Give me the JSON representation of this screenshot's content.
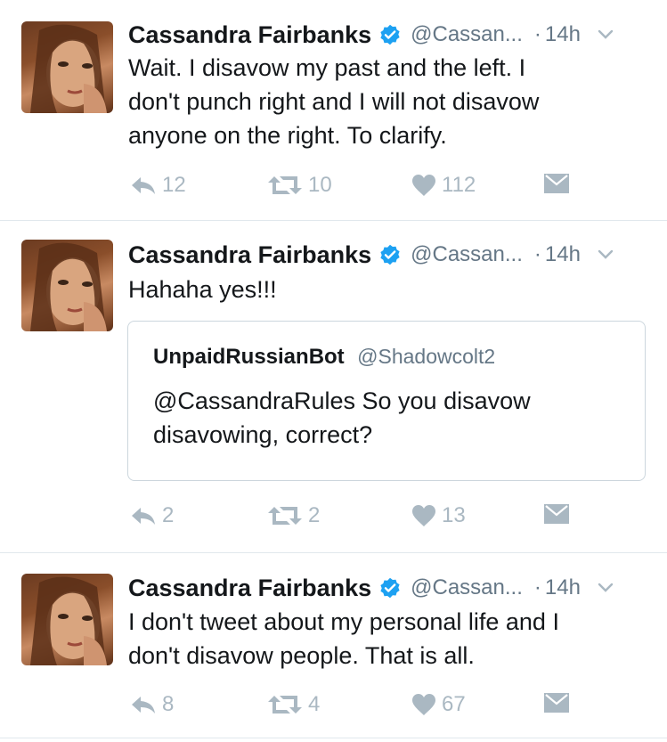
{
  "tweets": [
    {
      "name": "Cassandra Fairbanks",
      "handle": "@Cassan...",
      "time": "14h",
      "text_lines": [
        "Wait. I disavow my past and the left. I",
        "don't punch right and I will not disavow",
        "anyone on the right. To clarify."
      ],
      "replies": "12",
      "retweets": "10",
      "likes": "112"
    },
    {
      "name": "Cassandra Fairbanks",
      "handle": "@Cassan...",
      "time": "14h",
      "text_lines": [
        "Hahaha yes!!!"
      ],
      "quote": {
        "name": "UnpaidRussianBot",
        "handle": "@Shadowcolt2",
        "text_lines": [
          "@CassandraRules So you disavow",
          "disavowing, correct?"
        ]
      },
      "replies": "2",
      "retweets": "2",
      "likes": "13"
    },
    {
      "name": "Cassandra Fairbanks",
      "handle": "@Cassan...",
      "time": "14h",
      "text_lines": [
        "I don't tweet about my personal life and I",
        "don't disavow people. That is all."
      ],
      "replies": "8",
      "retweets": "4",
      "likes": "67"
    }
  ],
  "icons": {
    "verified": "verified-badge-icon",
    "caret": "chevron-down-icon",
    "reply": "reply-icon",
    "retweet": "retweet-icon",
    "like": "heart-icon",
    "dm": "envelope-icon"
  },
  "colors": {
    "verified": "#1da1f2",
    "action": "#aab8c2",
    "secondary_text": "#657786",
    "divider": "#e1e8ed"
  }
}
